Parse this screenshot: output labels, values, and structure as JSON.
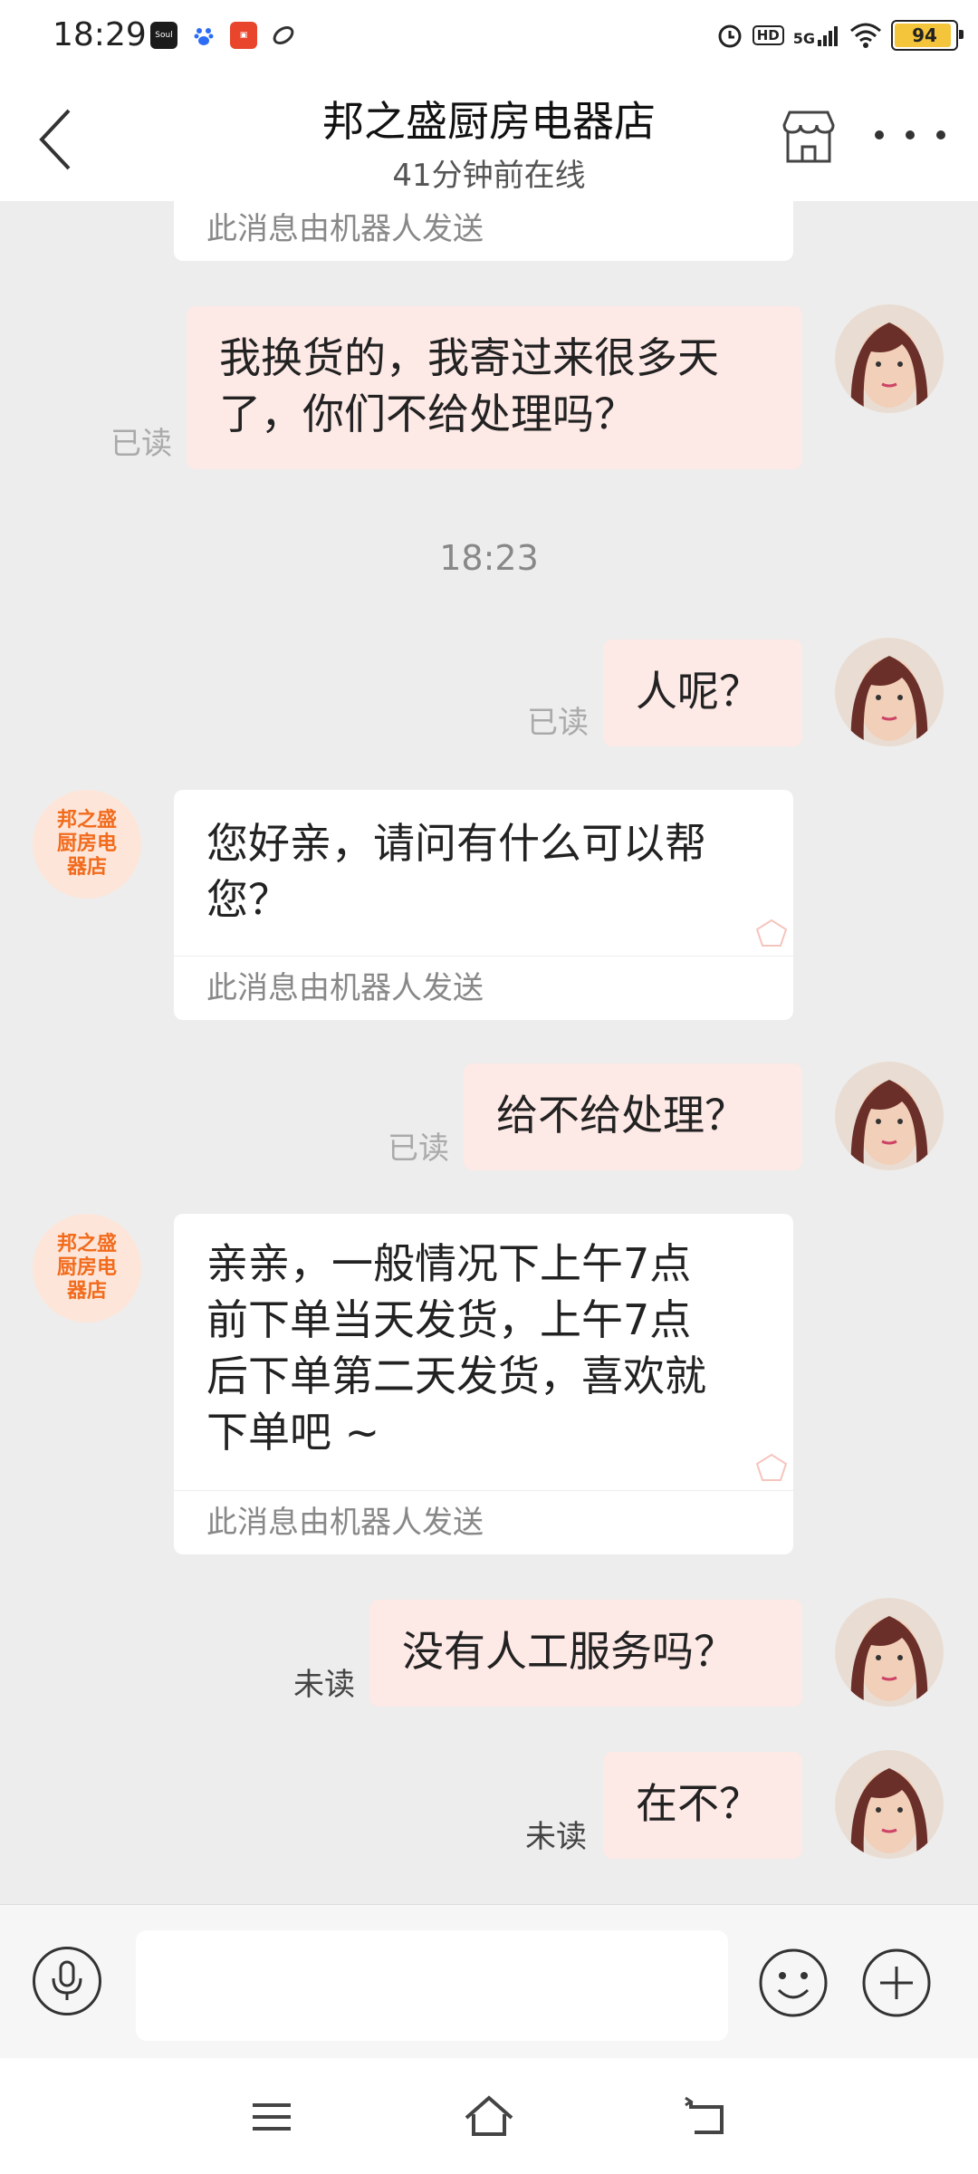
{
  "status_bar": {
    "time": "18:29",
    "app_icons": [
      "Soul",
      "baidu-paw",
      "app-red",
      "app-swirl"
    ],
    "network": "5G",
    "hd": "HD",
    "battery": "94"
  },
  "header": {
    "title": "邦之盛厨房电器店",
    "subtitle": "41分钟前在线"
  },
  "shop_avatar_text": [
    "邦之盛",
    "厨房电",
    "器店"
  ],
  "messages": {
    "m0_footer": "此消息由机器人发送",
    "m1_text_line1": "我换货的，我寄过来很多天",
    "m1_text_line2": "了，你们不给处理吗？",
    "m1_status": "已读",
    "timestamp": "18:23",
    "m2_text": "人呢？",
    "m2_status": "已读",
    "m3_text_line1": "您好亲，请问有什么可以帮",
    "m3_text_line2": "您？",
    "m3_footer": "此消息由机器人发送",
    "m4_text": "给不给处理？",
    "m4_status": "已读",
    "m5_text_line1": "亲亲，一般情况下上午7点",
    "m5_text_line2": "前下单当天发货，上午7点",
    "m5_text_line3": "后下单第二天发货，喜欢就",
    "m5_text_line4": "下单吧 ~",
    "m5_footer": "此消息由机器人发送",
    "m6_text": "没有人工服务吗？",
    "m6_status": "未读",
    "m7_text": "在不？",
    "m7_status": "未读"
  },
  "input": {
    "placeholder": ""
  },
  "colors": {
    "outgoing_bubble": "#fde9e6",
    "shop_accent": "#f26b1d",
    "battery": "#f4c53a"
  }
}
